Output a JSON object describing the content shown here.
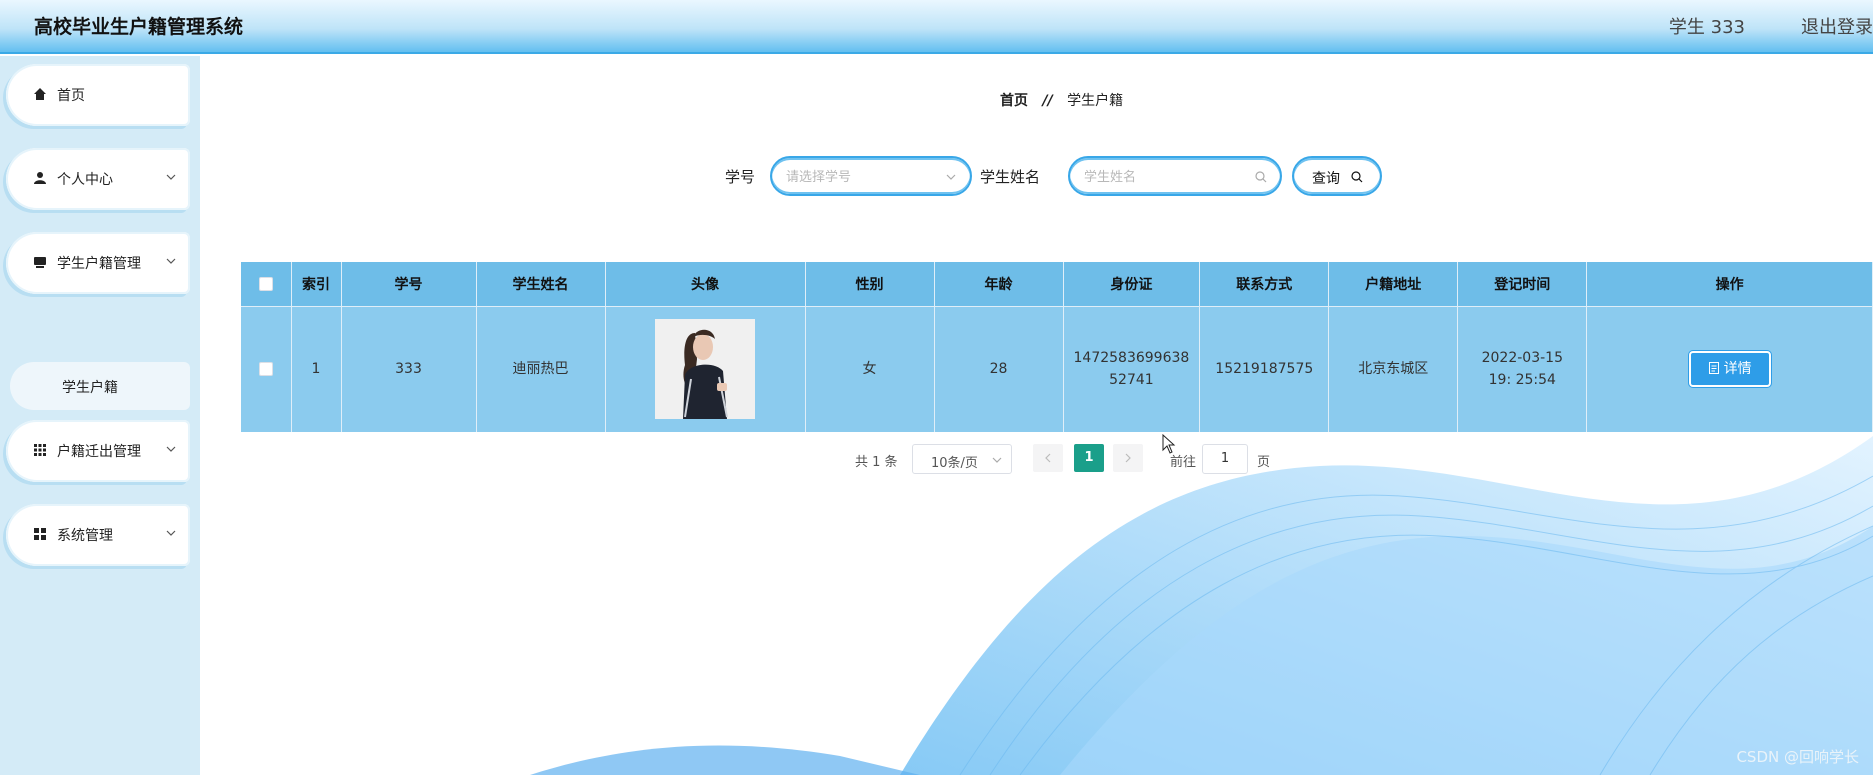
{
  "header": {
    "title": "高校毕业生户籍管理系统",
    "user": "学生 333",
    "logout": "退出登录"
  },
  "sidebar": {
    "items": [
      {
        "label": "首页",
        "icon": "home-icon"
      },
      {
        "label": "个人中心",
        "icon": "user-icon"
      },
      {
        "label": "学生户籍管理",
        "icon": "folder-icon"
      },
      {
        "label": "户籍迁出管理",
        "icon": "grid-icon"
      },
      {
        "label": "系统管理",
        "icon": "apps-icon"
      }
    ],
    "sub_item": "学生户籍"
  },
  "breadcrumb": {
    "home": "首页",
    "sep": "//",
    "current": "学生户籍"
  },
  "search": {
    "student_no_label": "学号",
    "student_no_placeholder": "请选择学号",
    "name_label": "学生姓名",
    "name_placeholder": "学生姓名",
    "query_label": "查询"
  },
  "table": {
    "headers": [
      "索引",
      "学号",
      "学生姓名",
      "头像",
      "性别",
      "年龄",
      "身份证",
      "联系方式",
      "户籍地址",
      "登记时间",
      "操作"
    ],
    "rows": [
      {
        "index": "1",
        "student_no": "333",
        "name": "迪丽热巴",
        "gender": "女",
        "age": "28",
        "id_card": "1472583699638 52741",
        "phone": "15219187575",
        "address": "北京东城区",
        "registered": "2022-03-15 19: 25:54",
        "action": "详情"
      }
    ]
  },
  "pagination": {
    "total": "共 1 条",
    "page_size": "10条/页",
    "current": "1",
    "goto": "前往",
    "goto_value": "1",
    "page": "页"
  },
  "watermark": "CSDN @回响学长",
  "colors": {
    "accent": "#38a7e8",
    "header_row": "#6ebde8",
    "body_row": "#8bcbee",
    "active_page": "#1a9f8a"
  }
}
